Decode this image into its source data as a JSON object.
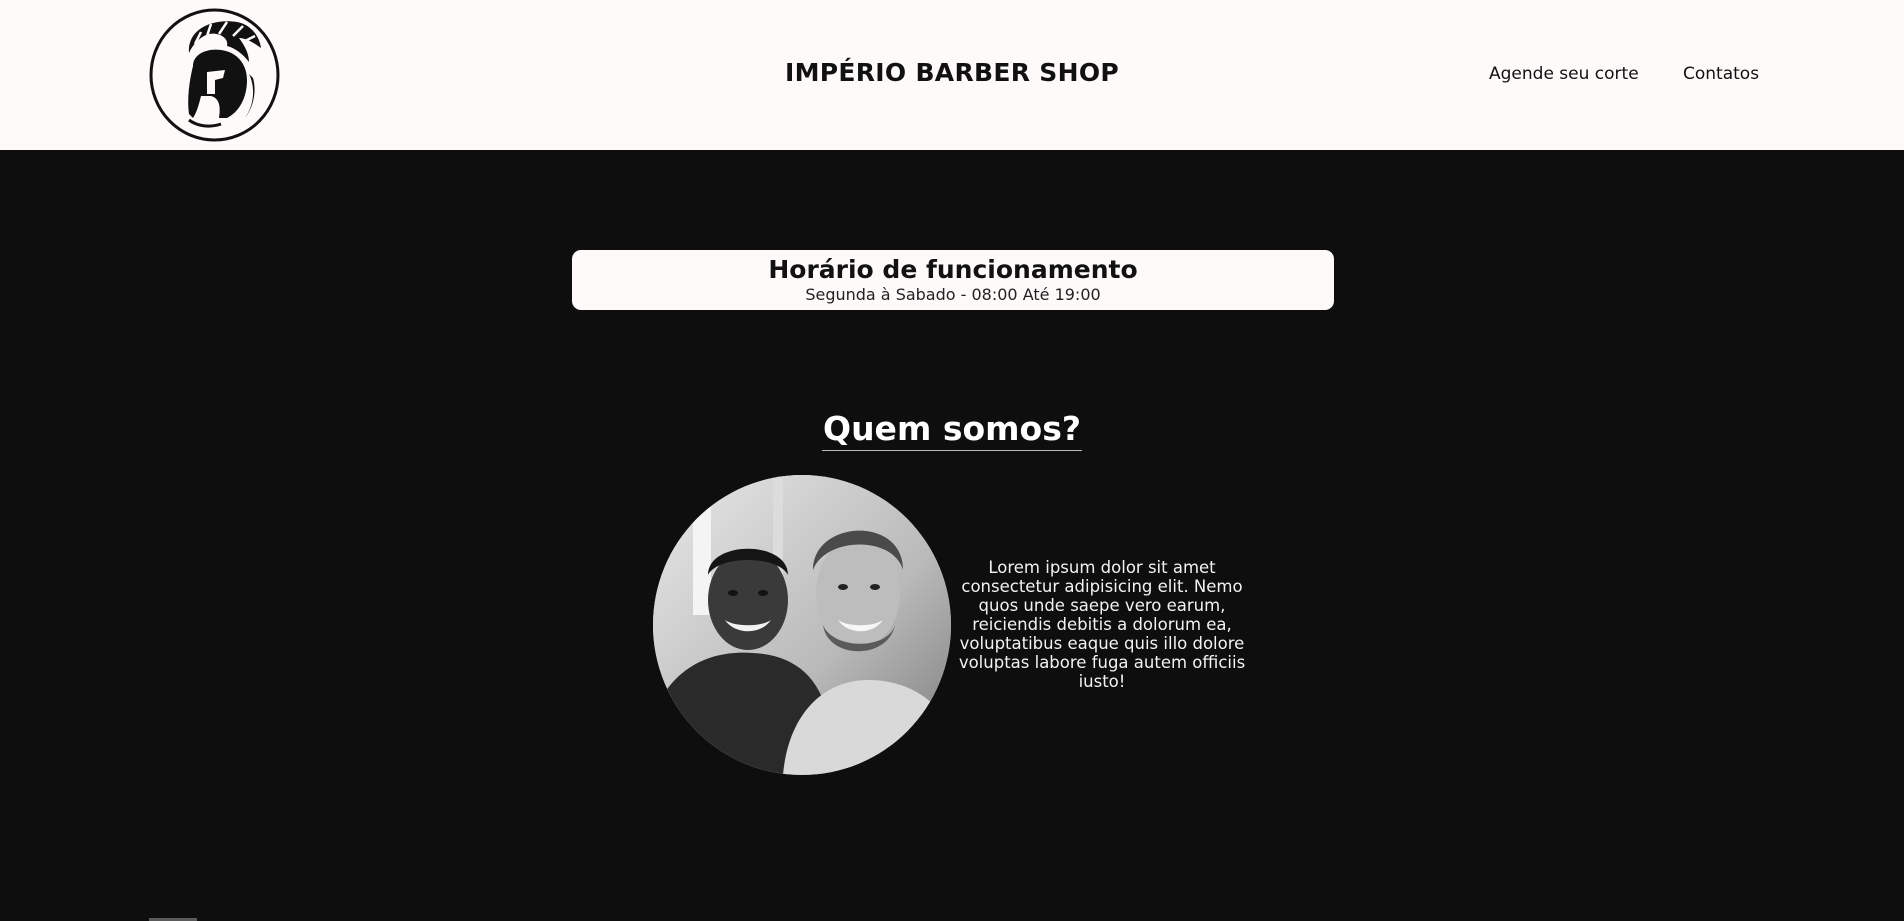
{
  "header": {
    "brand_title": "IMPÉRIO BARBER SHOP",
    "logo_icon": "spartan-helmet-icon",
    "nav": {
      "schedule_label": "Agende seu corte",
      "contacts_label": "Contatos"
    }
  },
  "hours": {
    "title": "Horário de funcionamento",
    "schedule": "Segunda à Sabado - 08:00 Até 19:00"
  },
  "about": {
    "title": "Quem somos?",
    "photo_icon": "two-smiling-men-photo",
    "text": "Lorem ipsum dolor sit amet consectetur adipisicing elit. Nemo quos unde saepe vero earum, reiciendis debitis a dolorum ea, voluptatibus eaque quis illo dolore voluptas labore fuga autem officiis iusto!"
  },
  "colors": {
    "header_bg": "#fdfaf9",
    "page_bg": "#0e0e0e",
    "text_dark": "#111111",
    "text_light": "#f2f2f2"
  }
}
